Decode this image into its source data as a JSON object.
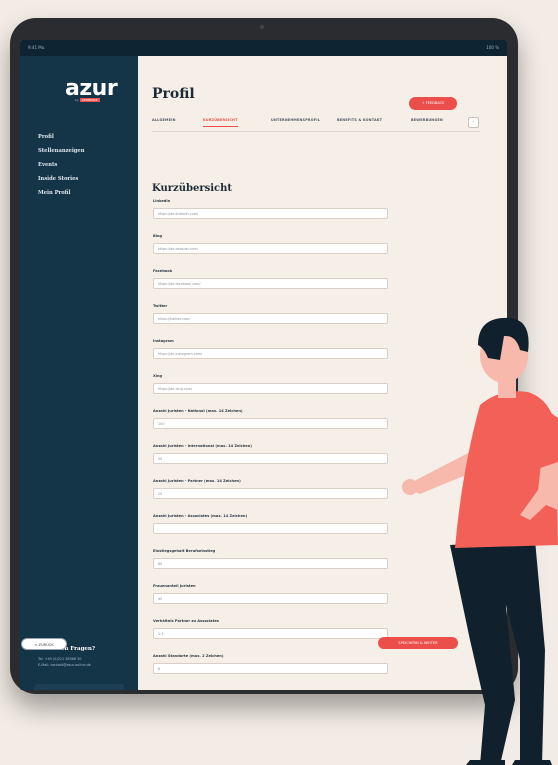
{
  "statusbar": {
    "left": "9:41 Mo.",
    "right": "100 %"
  },
  "sidebar": {
    "logo": "azur",
    "logo_sub_prefix": "by",
    "logo_sub_brand": "GEMEINDE",
    "nav": [
      "Profil",
      "Stellenanzeigen",
      "Events",
      "Inside Stories",
      "Mein Profil"
    ],
    "help": {
      "title": "Sie haben Fragen?",
      "phone": "Tel. +49 (0)211 58088 50",
      "email": "E-Mail: kontakt@azur-online.de"
    }
  },
  "header": {
    "title": "Profil",
    "feedback_label": "+ FEEDBACK",
    "tabs": [
      "ALLGEMEIN",
      "KURZÜBERSICHT",
      "UNTERNEHMENSPROFIL",
      "BENEFITS & KONTAKT",
      "BEWERBUNGEN"
    ],
    "more_label": "›"
  },
  "form": {
    "title": "Kurzübersicht",
    "fields": [
      {
        "label": "LinkedIn",
        "value": "https://de.linkedin.com/"
      },
      {
        "label": "Blog",
        "value": "https://de.beispiel.com/"
      },
      {
        "label": "Facebook",
        "value": "https://de.facebook.com/"
      },
      {
        "label": "Twitter",
        "value": "https://twitter.com/"
      },
      {
        "label": "Instagram",
        "value": "https://de.instagram.com/"
      },
      {
        "label": "Xing",
        "value": "https://de.xing.com/"
      },
      {
        "label": "Anzahl Juristen - National (max. 14 Zeichen)",
        "value": "100"
      },
      {
        "label": "Anzahl Juristen - International (max. 14 Zeichen)",
        "value": "50"
      },
      {
        "label": "Anzahl Juristen - Partner (max. 14 Zeichen)",
        "value": "20"
      },
      {
        "label": "Anzahl Juristen - Associates (max. 14 Zeichen)",
        "value": ""
      },
      {
        "label": "Einstiegsgehalt Berufseinstieg",
        "value": "80"
      },
      {
        "label": "Frauenanteil Juristen",
        "value": "40"
      },
      {
        "label": "Verhältnis Partner zu Associates",
        "value": "1:3"
      },
      {
        "label": "Anzahl Standorte (max. 2 Zeichen)",
        "value": "8"
      }
    ],
    "back_label": "< ZURÜCK",
    "save_label": "SPEICHERN & WEITER"
  },
  "colors": {
    "accent": "#ec4f4b",
    "sidebar": "#143448",
    "background": "#f3ece6"
  }
}
